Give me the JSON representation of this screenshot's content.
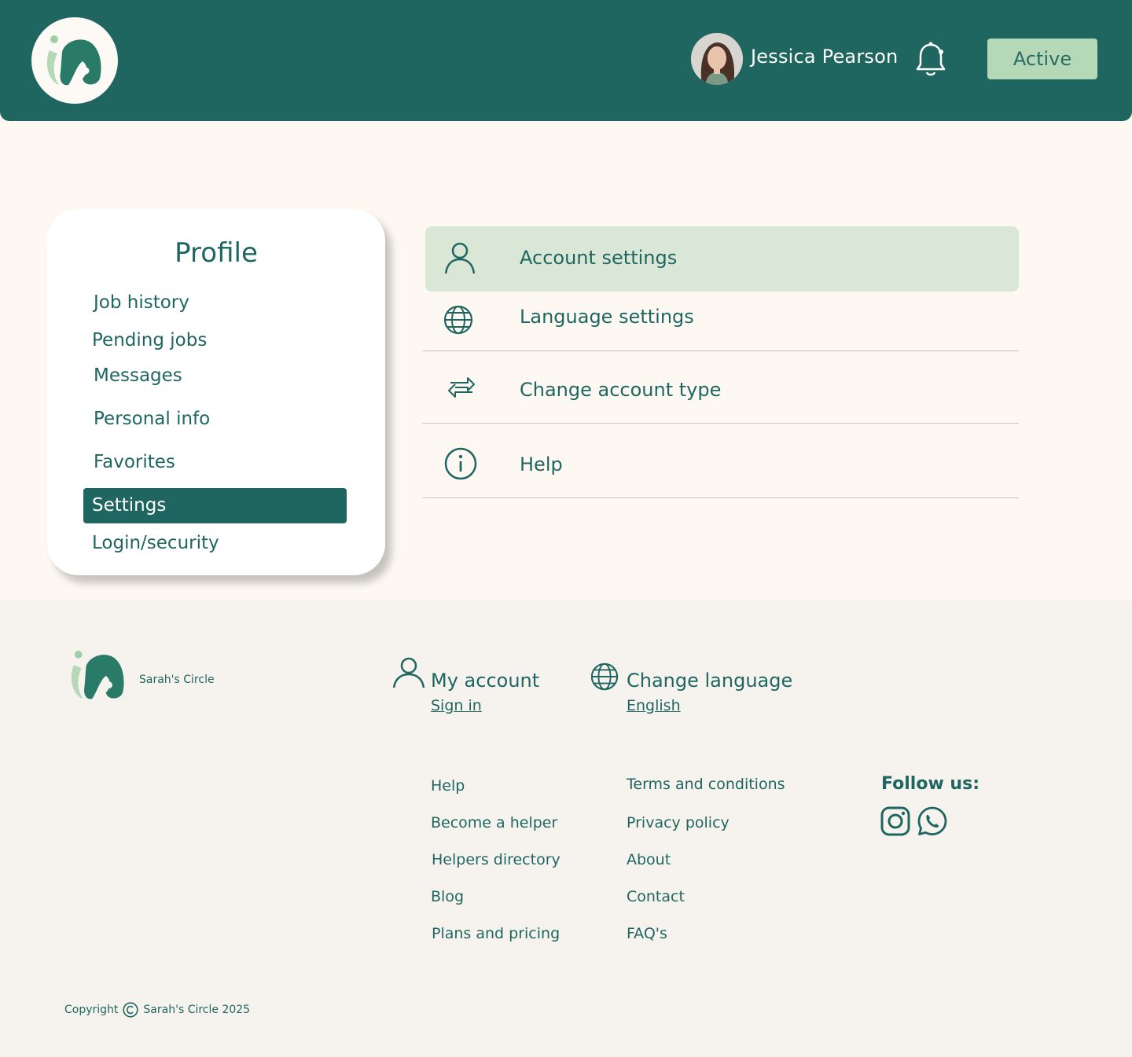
{
  "header": {
    "user_name": "Jessica Pearson",
    "status_label": "Active"
  },
  "profile": {
    "title": "Profile",
    "items": [
      {
        "label": "Job history"
      },
      {
        "label": "Pending jobs"
      },
      {
        "label": "Messages"
      },
      {
        "label": "Personal info"
      },
      {
        "label": "Favorites"
      },
      {
        "label": "Settings",
        "active": true
      },
      {
        "label": "Login/security"
      }
    ]
  },
  "settings": {
    "items": [
      {
        "label": "Account settings",
        "icon": "user-icon",
        "selected": true
      },
      {
        "label": "Language settings",
        "icon": "globe-icon"
      },
      {
        "label": "Change account type",
        "icon": "swap-arrows-icon"
      },
      {
        "label": "Help",
        "icon": "info-icon"
      }
    ]
  },
  "footer": {
    "brand": "Sarah's Circle",
    "my_account": {
      "heading": "My account",
      "link": "Sign in"
    },
    "change_language": {
      "heading": "Change language",
      "link": "English"
    },
    "links_col1": [
      "Help",
      "Become a helper",
      "Helpers directory",
      "Blog",
      "Plans and pricing"
    ],
    "links_col2": [
      "Terms and conditions",
      "Privacy policy",
      "About",
      "Contact",
      "FAQ's"
    ],
    "follow_label": "Follow us:",
    "social": [
      "instagram-icon",
      "whatsapp-icon"
    ],
    "copyright_prefix": "Copyright",
    "copyright_text": "Sarah's Circle 2025"
  },
  "colors": {
    "primary": "#1f6660",
    "accent_light": "#b5d9b7",
    "selected_row": "#dbe7d6",
    "page_bg": "#fdf8f2",
    "footer_bg": "#f6f3ef"
  }
}
